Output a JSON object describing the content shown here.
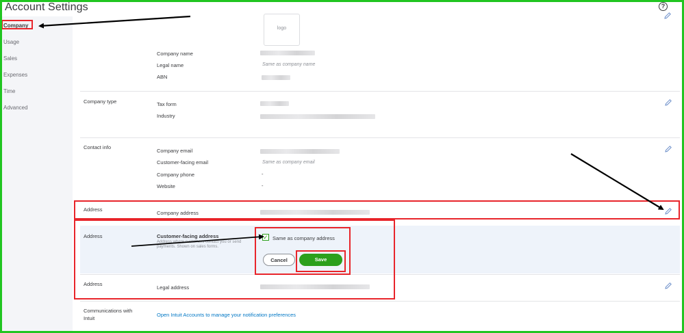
{
  "header": {
    "title": "Account Settings",
    "help_icon": "?"
  },
  "sidebar": {
    "items": [
      {
        "label": "Company",
        "active": true
      },
      {
        "label": "Usage"
      },
      {
        "label": "Sales"
      },
      {
        "label": "Expenses"
      },
      {
        "label": "Time"
      },
      {
        "label": "Advanced"
      }
    ]
  },
  "company_name_section": {
    "logo_text": "logo",
    "rows": [
      {
        "label": "Company name",
        "value": ""
      },
      {
        "label": "Legal name",
        "value": "Same as company name"
      },
      {
        "label": "ABN",
        "value": ""
      }
    ]
  },
  "company_type": {
    "section": "Company type",
    "rows": [
      {
        "label": "Tax form",
        "value": ""
      },
      {
        "label": "Industry",
        "value": ""
      }
    ]
  },
  "contact_info": {
    "section": "Contact info",
    "rows": [
      {
        "label": "Company email",
        "value": ""
      },
      {
        "label": "Customer-facing email",
        "value": "Same as company email"
      },
      {
        "label": "Company phone",
        "value": "-"
      },
      {
        "label": "Website",
        "value": "-"
      }
    ]
  },
  "address": {
    "section": "Address",
    "company_address_label": "Company address"
  },
  "address_edit": {
    "section": "Address",
    "customer_facing_label": "Customer-facing address",
    "customer_facing_help_1": "Address where customers contact you or send",
    "customer_facing_help_2": "payments. Shown on sales forms.",
    "checkbox_label": "Same as company address",
    "checkbox_checked": true,
    "cancel_label": "Cancel",
    "save_label": "Save"
  },
  "legal_address": {
    "section": "Address",
    "label": "Legal address"
  },
  "communications": {
    "section_line1": "Communications with",
    "section_line2": "Intuit",
    "link": "Open Intuit Accounts to manage your notification preferences"
  },
  "colors": {
    "accent_green": "#2ca01c",
    "annotation_red": "#e8242a",
    "frame_green": "#21c521",
    "link_blue": "#0077c5"
  }
}
